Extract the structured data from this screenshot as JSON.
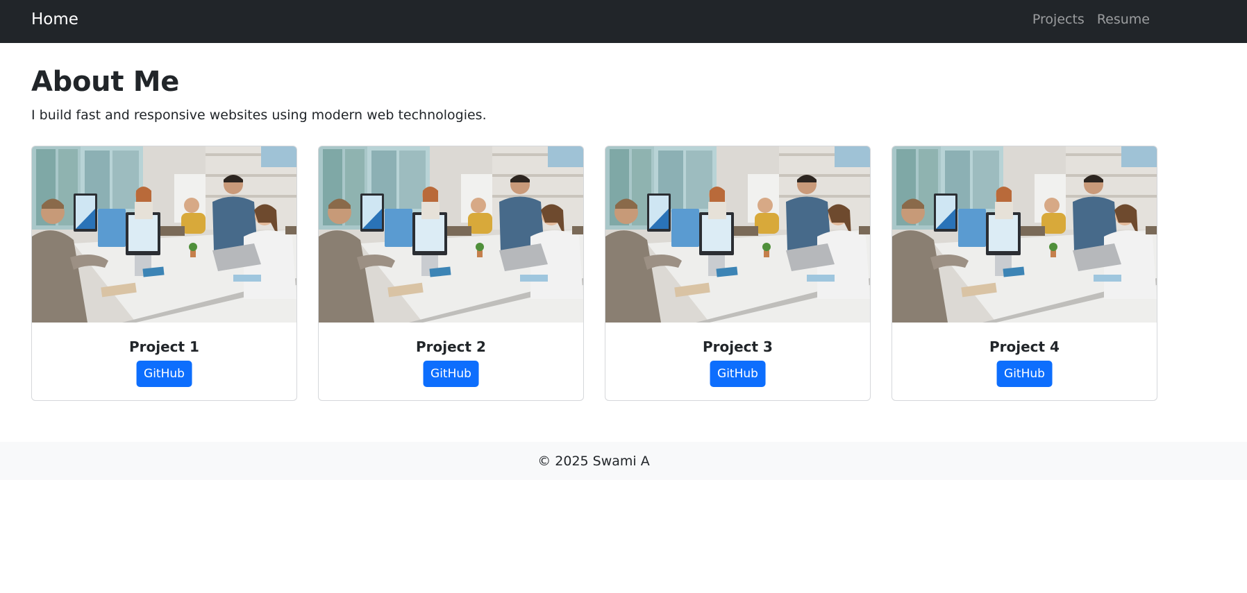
{
  "navbar": {
    "brand": "Home",
    "links": [
      {
        "label": "Projects"
      },
      {
        "label": "Resume"
      }
    ]
  },
  "main": {
    "title": "About Me",
    "intro": "I build fast and responsive websites using modern web technologies."
  },
  "projects": [
    {
      "title": "Project 1",
      "button_label": "GitHub"
    },
    {
      "title": "Project 2",
      "button_label": "GitHub"
    },
    {
      "title": "Project 3",
      "button_label": "GitHub"
    },
    {
      "title": "Project 4",
      "button_label": "GitHub"
    }
  ],
  "footer": {
    "text": "© 2025 Swami A"
  },
  "colors": {
    "navbar_bg": "#212529",
    "primary": "#0d6efd",
    "footer_bg": "#f8f9fa"
  }
}
